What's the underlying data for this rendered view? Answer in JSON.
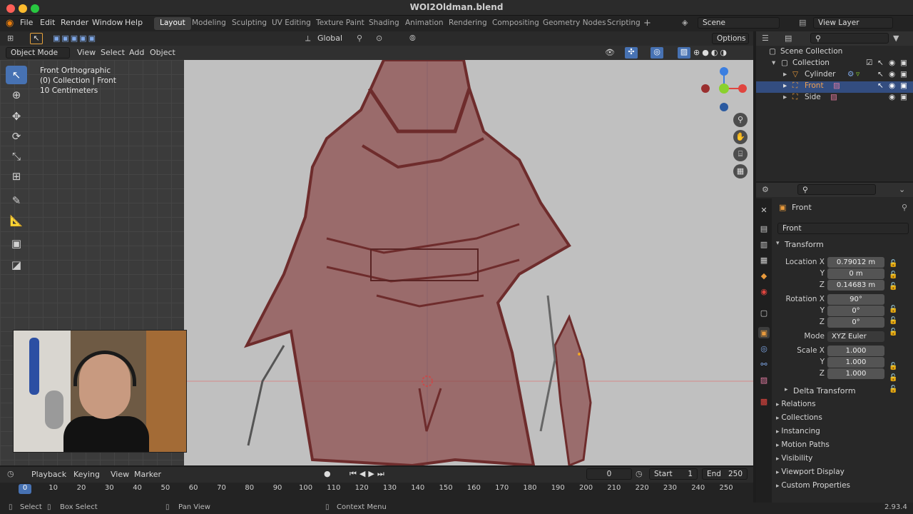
{
  "window": {
    "title": "WOI2Oldman.blend"
  },
  "menu": [
    "File",
    "Edit",
    "Render",
    "Window",
    "Help"
  ],
  "workspaces": [
    "Layout",
    "Modeling",
    "Sculpting",
    "UV Editing",
    "Texture Paint",
    "Shading",
    "Animation",
    "Rendering",
    "Compositing",
    "Geometry Nodes",
    "Scripting"
  ],
  "scene": {
    "label": "Scene",
    "view_layer": "View Layer"
  },
  "header": {
    "orientation": "Global",
    "options": "Options"
  },
  "viewport_header": {
    "mode": "Object Mode",
    "items": [
      "View",
      "Select",
      "Add",
      "Object"
    ]
  },
  "viewport_info": {
    "line1": "Front Orthographic",
    "line2": "(0) Collection | Front",
    "line3": "10 Centimeters"
  },
  "outliner": {
    "scene_collection": "Scene Collection",
    "collection": "Collection",
    "items": [
      "Cylinder",
      "Front",
      "Side"
    ]
  },
  "properties": {
    "object_name": "Front",
    "datablock": "Front",
    "transform_label": "Transform",
    "location": {
      "label": "Location X",
      "x": "0.79012 m",
      "y": "0 m",
      "z": "0.14683 m"
    },
    "rotation": {
      "label": "Rotation X",
      "x": "90°",
      "y": "0°",
      "z": "0°"
    },
    "mode": {
      "label": "Mode",
      "value": "XYZ Euler"
    },
    "scale": {
      "label": "Scale X",
      "x": "1.000",
      "y": "1.000",
      "z": "1.000"
    },
    "axis_y": "Y",
    "axis_z": "Z",
    "delta": "Delta Transform",
    "sections": [
      "Relations",
      "Collections",
      "Instancing",
      "Motion Paths",
      "Visibility",
      "Viewport Display",
      "Custom Properties"
    ]
  },
  "timeline": {
    "menus": [
      "Playback",
      "Keying",
      "View",
      "Marker"
    ],
    "current_frame": "0",
    "start_label": "Start",
    "start": "1",
    "end_label": "End",
    "end": "250",
    "ticks": [
      "0",
      "10",
      "20",
      "30",
      "40",
      "50",
      "60",
      "70",
      "80",
      "90",
      "100",
      "110",
      "120",
      "130",
      "140",
      "150",
      "160",
      "170",
      "180",
      "190",
      "200",
      "210",
      "220",
      "230",
      "240",
      "250"
    ]
  },
  "statusbar": {
    "select": "Select",
    "box_select": "Box Select",
    "pan": "Pan View",
    "context": "Context Menu",
    "version": "2.93.4"
  },
  "colors": {
    "accent": "#4772b3",
    "selection": "#334d80",
    "sketch": "#7a3b3b",
    "axis_x": "#e0453f",
    "axis_y": "#8ad12e",
    "axis_z": "#3b7ee0"
  }
}
